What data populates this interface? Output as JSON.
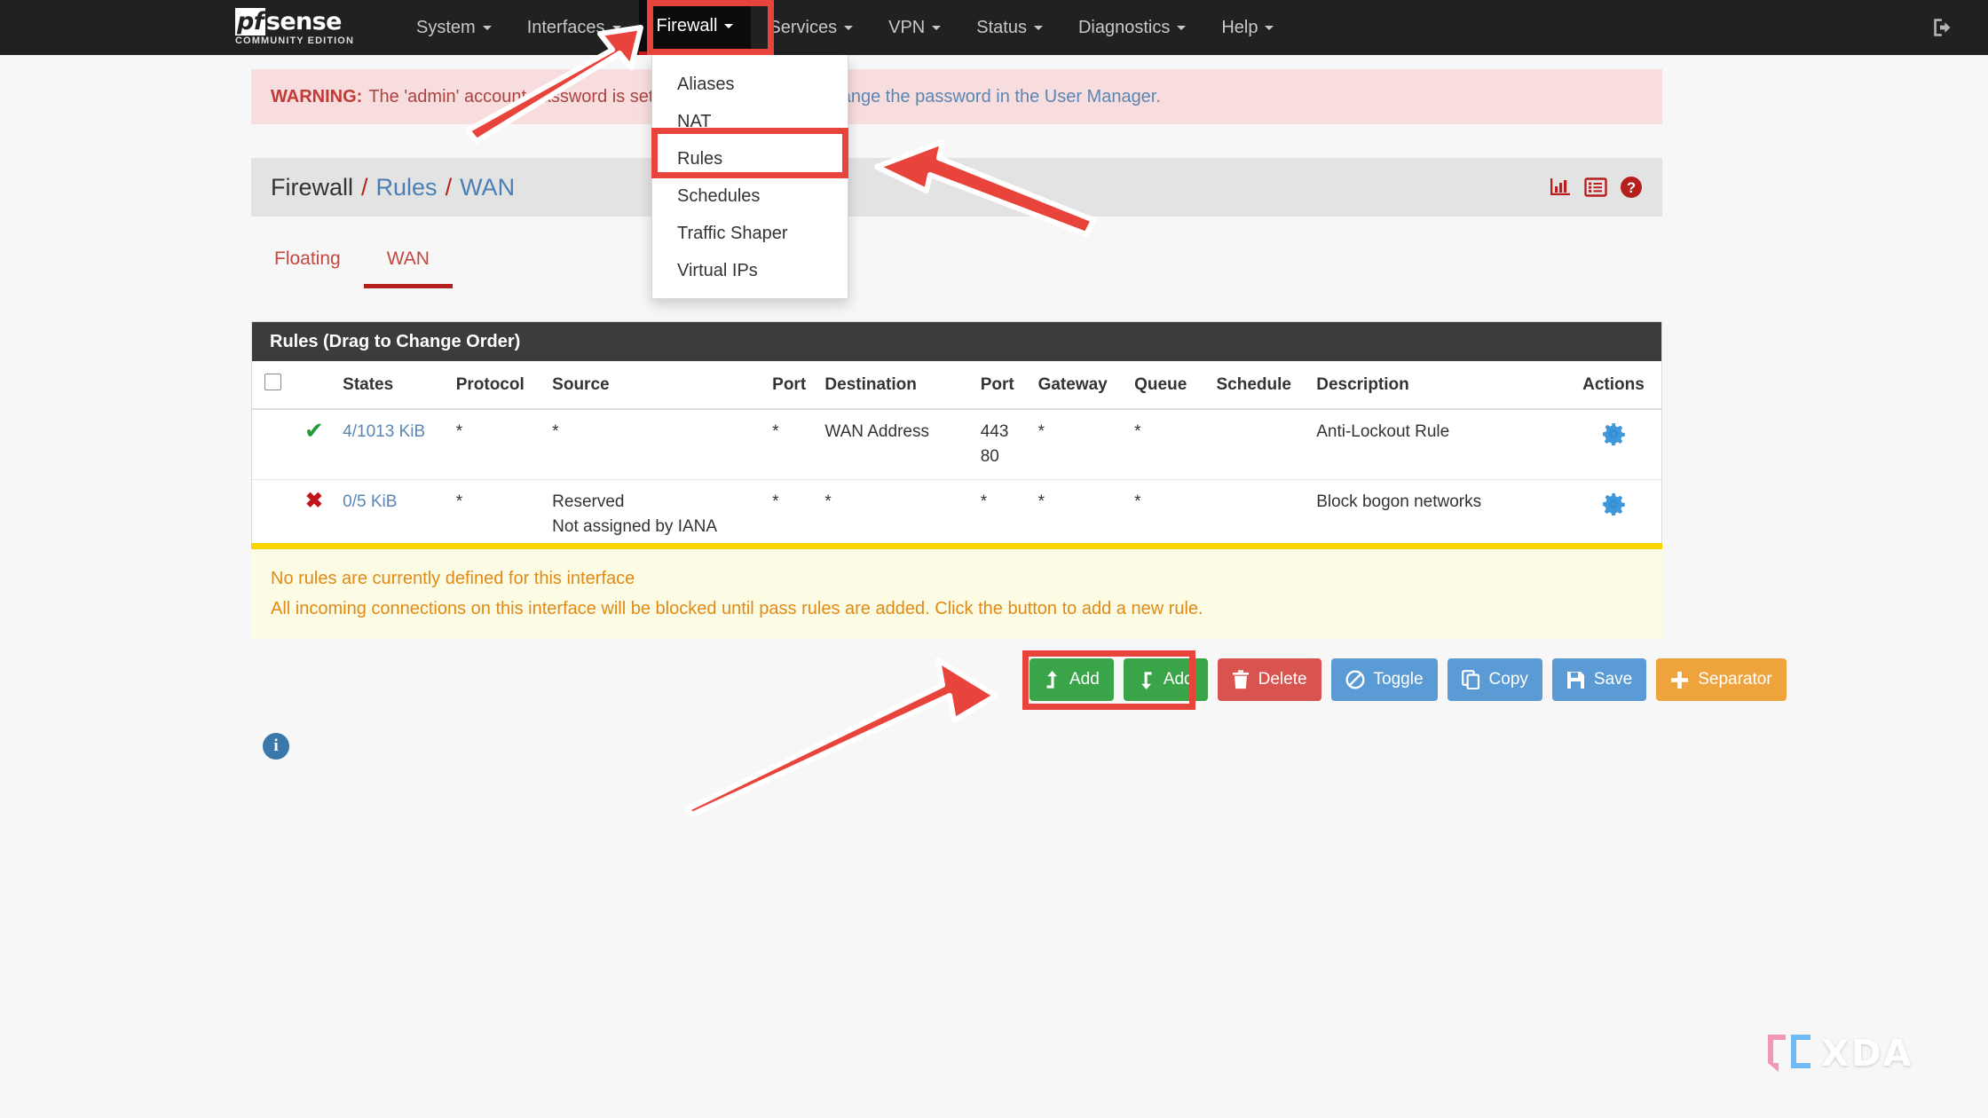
{
  "navbar": {
    "brand": {
      "logo_pf": "pf",
      "logo_sense": "sense",
      "subtitle": "COMMUNITY EDITION"
    },
    "items": [
      {
        "label": "System",
        "active": false
      },
      {
        "label": "Interfaces",
        "active": false
      },
      {
        "label": "Firewall",
        "active": true
      },
      {
        "label": "Services",
        "active": false
      },
      {
        "label": "VPN",
        "active": false
      },
      {
        "label": "Status",
        "active": false
      },
      {
        "label": "Diagnostics",
        "active": false
      },
      {
        "label": "Help",
        "active": false
      }
    ],
    "signout_icon": "sign-out-icon"
  },
  "dropdown": {
    "owner": "Firewall",
    "items": [
      {
        "label": "Aliases",
        "highlighted": false
      },
      {
        "label": "NAT",
        "highlighted": false
      },
      {
        "label": "Rules",
        "highlighted": true
      },
      {
        "label": "Schedules",
        "highlighted": false
      },
      {
        "label": "Traffic Shaper",
        "highlighted": false
      },
      {
        "label": "Virtual IPs",
        "highlighted": false
      }
    ]
  },
  "warning": {
    "label": "WARNING:",
    "text_1": "The 'admin' account password is set to the default value.",
    "text_2": "Change the password in the User Manager."
  },
  "breadcrumb": {
    "part_1": "Firewall",
    "part_2": "Rules",
    "part_3": "WAN",
    "separator": "/",
    "icons": [
      "bar-chart-icon",
      "list-icon",
      "help-icon"
    ]
  },
  "tabs": [
    {
      "label": "Floating",
      "active": false
    },
    {
      "label": "WAN",
      "active": true
    }
  ],
  "rules_panel": {
    "title": "Rules (Drag to Change Order)",
    "columns": [
      "",
      "",
      "States",
      "Protocol",
      "Source",
      "Port",
      "Destination",
      "Port",
      "Gateway",
      "Queue",
      "Schedule",
      "Description",
      "Actions"
    ],
    "rows": [
      {
        "status_icon": "pass-check-icon",
        "status_glyph": "✔",
        "states": "4/1013 KiB",
        "protocol": "*",
        "source": "*",
        "source_sub": "",
        "source_port": "*",
        "destination": "WAN Address",
        "dest_port": "443",
        "dest_port_sub": "80",
        "gateway": "*",
        "queue": "*",
        "schedule": "",
        "description": "Anti-Lockout Rule",
        "action_icon": "gear-icon"
      },
      {
        "status_icon": "block-x-icon",
        "status_glyph": "✖",
        "states": "0/5 KiB",
        "protocol": "*",
        "source": "Reserved",
        "source_sub": "Not assigned by IANA",
        "source_port": "*",
        "destination": "*",
        "dest_port": "*",
        "dest_port_sub": "",
        "gateway": "*",
        "queue": "*",
        "schedule": "",
        "description": "Block bogon networks",
        "action_icon": "gear-icon"
      }
    ]
  },
  "info_alert": {
    "line_1": "No rules are currently defined for this interface",
    "line_2": "All incoming connections on this interface will be blocked until pass rules are added. Click the button to add a new rule."
  },
  "buttons": [
    {
      "label": "Add",
      "icon": "arrow-up-icon",
      "color": "#3aa449",
      "style": "btn-green"
    },
    {
      "label": "Add",
      "icon": "arrow-down-icon",
      "color": "#3aa449",
      "style": "btn-green"
    },
    {
      "label": "Delete",
      "icon": "trash-icon",
      "color": "#d9534f",
      "style": "btn-red"
    },
    {
      "label": "Toggle",
      "icon": "ban-icon",
      "color": "#5b9bd5",
      "style": "btn-blue"
    },
    {
      "label": "Copy",
      "icon": "copy-icon",
      "color": "#5b9bd5",
      "style": "btn-blue"
    },
    {
      "label": "Save",
      "icon": "floppy-save-icon",
      "color": "#5b9bd5",
      "style": "btn-blue"
    },
    {
      "label": "Separator",
      "icon": "plus-icon",
      "color": "#efa33d",
      "style": "btn-orange"
    }
  ],
  "footer_info_icon": {
    "glyph": "i",
    "name": "info-icon"
  },
  "watermark": {
    "text": "XDA",
    "bracket_left_color": "#f48fb1",
    "bracket_right_color": "#64b5f6"
  },
  "annotations": {
    "accent_color": "#e8443c",
    "highlight_firewall_menu": true,
    "highlight_rules_item": true,
    "highlight_add_buttons": true,
    "arrows": 3
  }
}
